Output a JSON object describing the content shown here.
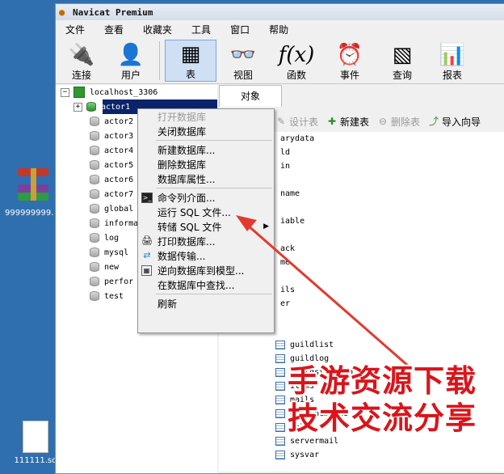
{
  "desktop": {
    "winrar_label": "999999999.",
    "sql_label": "111111.sq"
  },
  "window": {
    "title": "Navicat Premium"
  },
  "menubar": [
    "文件",
    "查看",
    "收藏夹",
    "工具",
    "窗口",
    "帮助"
  ],
  "toolbar": {
    "connect": "连接",
    "user": "用户",
    "table": "表",
    "view": "视图",
    "function": "函数",
    "event": "事件",
    "query": "查询",
    "report": "报表"
  },
  "tree": {
    "connection": "localhost_3306",
    "databases": [
      "actor1",
      "actor2",
      "actor3",
      "actor4",
      "actor5",
      "actor6",
      "actor7",
      "global",
      "informa",
      "log",
      "mysql",
      "new",
      "perfor",
      "test"
    ]
  },
  "objects": {
    "tab": "对象",
    "toolbar": {
      "design": "设计表",
      "new": "新建表",
      "delete": "删除表",
      "import": "导入向导"
    },
    "partial_items": [
      "arydata",
      "ld",
      "in",
      "name",
      "iable",
      "ack",
      "me",
      "ils",
      "er"
    ],
    "items": [
      "guildlist",
      "guildlog",
      "guildstorelog",
      "items",
      "mails",
      "offlinemails",
      "roles",
      "servermail",
      "sysvar"
    ]
  },
  "context_menu": {
    "open": "打开数据库",
    "close": "关闭数据库",
    "new_db": "新建数据库...",
    "delete_db": "删除数据库",
    "db_props": "数据库属性...",
    "console": "命令列介面...",
    "run_sql": "运行 SQL 文件...",
    "dump_sql": "转储 SQL 文件",
    "print_db": "打印数据库...",
    "transfer": "数据传输...",
    "reverse": "逆向数据库到模型...",
    "find": "在数据库中查找...",
    "refresh": "刷新"
  },
  "watermark": {
    "line1": "手游资源下载",
    "line2": "技术交流分享",
    "color": "#d9151b"
  }
}
